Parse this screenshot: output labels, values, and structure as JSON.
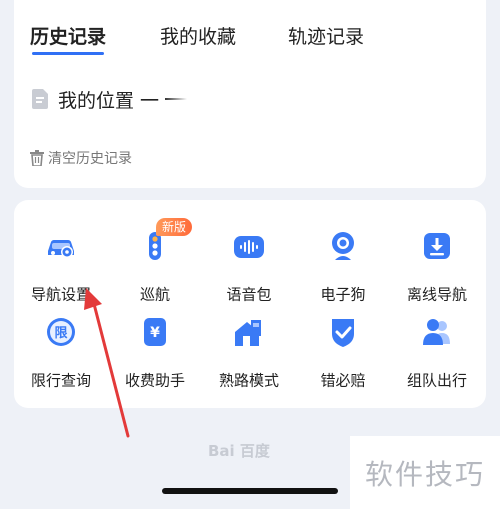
{
  "tabs": [
    {
      "label": "历史记录",
      "active": true
    },
    {
      "label": "我的收藏",
      "active": false
    },
    {
      "label": "轨迹记录",
      "active": false
    }
  ],
  "history": {
    "items": [
      {
        "label": "我的位置 一",
        "icon": "document-icon"
      }
    ],
    "clear_label": "清空历史记录"
  },
  "tools": [
    {
      "label": "导航设置",
      "icon": "car-settings-icon"
    },
    {
      "label": "巡航",
      "icon": "traffic-light-icon",
      "badge": "新版"
    },
    {
      "label": "语音包",
      "icon": "voice-pack-icon"
    },
    {
      "label": "电子狗",
      "icon": "camera-icon"
    },
    {
      "label": "离线导航",
      "icon": "download-icon"
    },
    {
      "label": "限行查询",
      "icon": "restriction-icon"
    },
    {
      "label": "收费助手",
      "icon": "toll-icon"
    },
    {
      "label": "熟路模式",
      "icon": "familiar-road-icon"
    },
    {
      "label": "错必赔",
      "icon": "shield-check-icon"
    },
    {
      "label": "组队出行",
      "icon": "team-icon"
    }
  ],
  "restriction_icon_text": "限",
  "toll_icon_text": "¥",
  "watermark": "Bai 百度",
  "corner_brand": "软件技巧",
  "colors": {
    "accent": "#3070f5",
    "badge": "#ff6a3a",
    "background": "#eef1f7"
  }
}
